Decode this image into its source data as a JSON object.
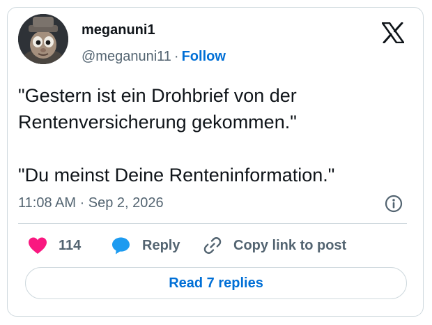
{
  "author": {
    "display_name": "meganuni1",
    "handle": "@meganuni11",
    "separator": "·",
    "follow_label": "Follow",
    "avatar_icon": "avatar-figure-with-hat"
  },
  "brand_icon": "x-logo-icon",
  "tweet": {
    "paragraphs": [
      "\"Gestern ist ein Drohbrief von der Rentenversicherung gekommen.\"",
      "\"Du meinst Deine Renteninformation.\""
    ],
    "timestamp": "11:08 AM · Sep 2, 2026"
  },
  "actions": {
    "like_count": "114",
    "reply_label": "Reply",
    "copy_link_label": "Copy link to post"
  },
  "read_replies_label": "Read 7 replies",
  "colors": {
    "link_blue": "#006fd6",
    "like_pink": "#f91880",
    "reply_blue": "#1d9bf0",
    "secondary_text": "#536471",
    "border": "#cfd9de"
  }
}
